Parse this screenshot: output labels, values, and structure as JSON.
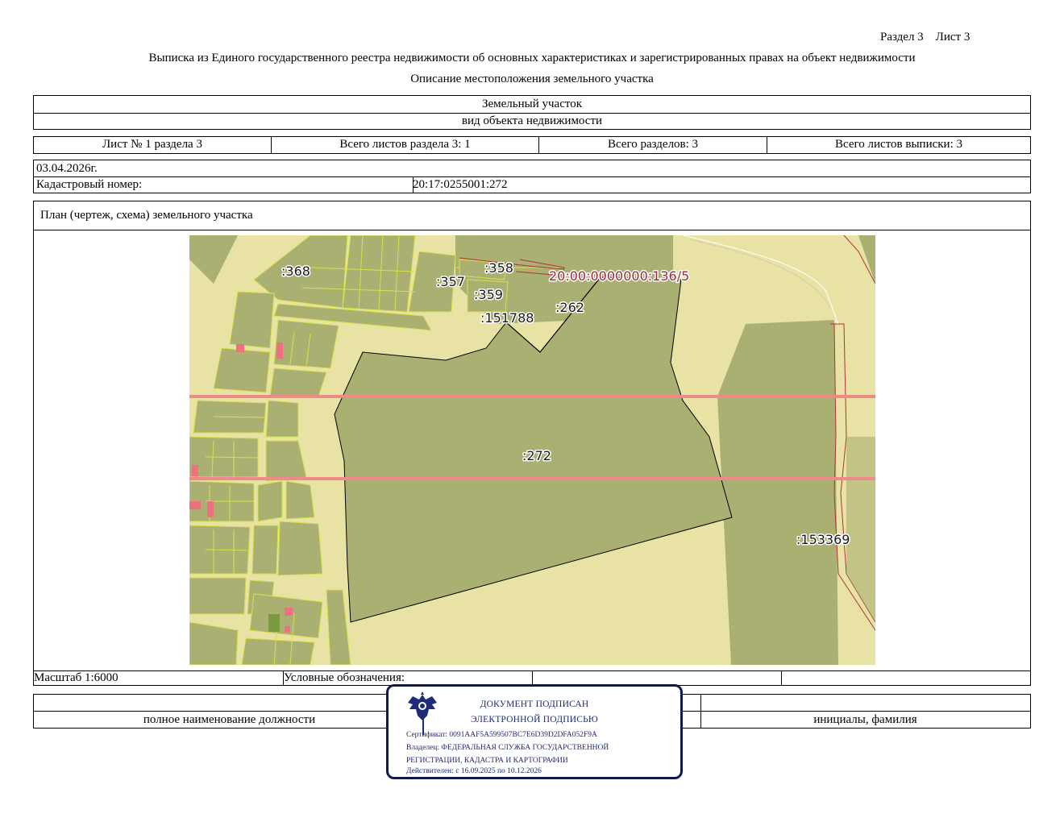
{
  "header": {
    "section_sheet": "Раздел 3    Лист 3",
    "title": "Выписка из Единого государственного реестра недвижимости об основных характеристиках и зарегистрированных правах на объект недвижимости",
    "subtitle": "Описание местоположения земельного участка"
  },
  "object": {
    "type_value": "Земельный участок",
    "type_caption": "вид объекта недвижимости"
  },
  "sheets": {
    "sheet_no": "Лист № 1 раздела 3",
    "sheets_in_section": "Всего листов раздела 3: 1",
    "total_sections": "Всего разделов: 3",
    "total_sheets": "Всего листов выписки: 3"
  },
  "meta": {
    "date": "03.04.2026г.",
    "cadastral_label": "Кадастровый номер:",
    "cadastral_value": "20:17:0255001:272"
  },
  "plan": {
    "title": "План (чертеж, схема) земельного участка",
    "labels": {
      "l368": ":368",
      "l357": ":357",
      "l358": ":358",
      "l359": ":359",
      "l151788": ":151788",
      "l262": ":262",
      "zone": "20:00:0000000:136/5",
      "l272": ":272",
      "l153369": ":153369"
    },
    "colors": {
      "background": "#e8e2a4",
      "parcel_fill": "#a9b072",
      "parcel_edge": "#d8e04a",
      "zone_line": "#f08a8a",
      "building": "#f07080"
    }
  },
  "footer": {
    "scale": "Масштаб 1:6000",
    "legend_label": "Условные обозначения:",
    "position_caption": "полное наименование должности",
    "name_caption": "инициалы, фамилия"
  },
  "stamp": {
    "line1": "ДОКУМЕНТ ПОДПИСАН",
    "line2": "ЭЛЕКТРОННОЙ ПОДПИСЬЮ",
    "certificate": "Сертификат: 0091AAF5A599507BC7E6D39D2DFA052F9A",
    "owner_line1": "Владелец: ФЕДЕРАЛЬНАЯ СЛУЖБА ГОСУДАРСТВЕННОЙ",
    "owner_line2": "РЕГИСТРАЦИИ, КАДАСТРА И КАРТОГРАФИИ",
    "valid": "Действителен: с 16.09.2025 по 10.12.2026",
    "emblem_icon": "double-headed-eagle-emblem"
  }
}
